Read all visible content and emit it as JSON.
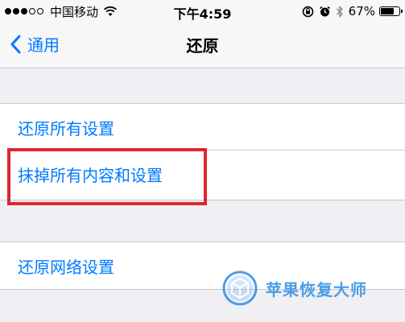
{
  "status_bar": {
    "carrier": "中国移动",
    "time": "下午4:59",
    "battery_percent_text": "67%",
    "battery_level": 0.67,
    "signal_bars_full": 3,
    "signal_bars_total": 5
  },
  "nav": {
    "back_label": "通用",
    "title": "还原"
  },
  "reset_group_1": {
    "items": [
      {
        "label": "还原所有设置"
      },
      {
        "label": "抹掉所有内容和设置"
      }
    ]
  },
  "reset_group_2": {
    "items": [
      {
        "label": "还原网络设置"
      }
    ]
  },
  "watermark": {
    "text": "苹果恢复大师"
  },
  "colors": {
    "accent": "#007aff",
    "highlight": "#e0262d",
    "background": "#efeff4",
    "watermark": "#2d8ee4"
  },
  "icons": [
    "wifi-icon",
    "lock-rotation-icon",
    "alarm-icon",
    "bluetooth-icon",
    "battery-icon",
    "back-chevron-icon",
    "watermark-logo-icon"
  ]
}
